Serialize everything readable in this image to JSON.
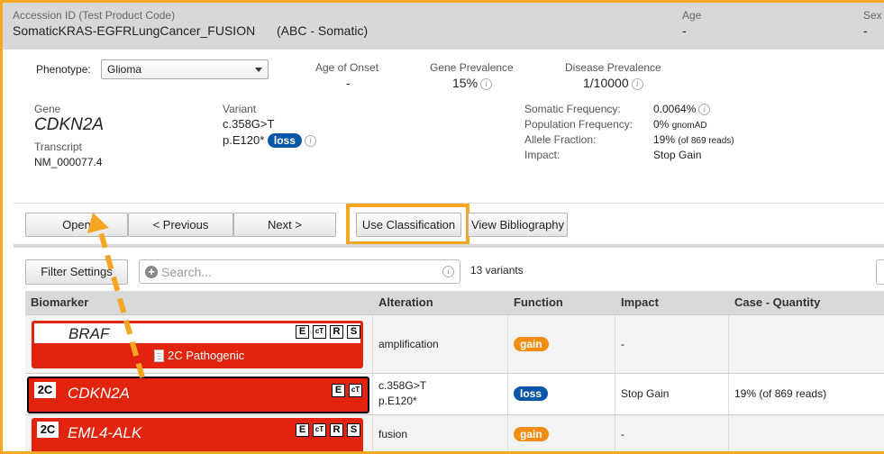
{
  "header": {
    "accession_label": "Accession ID (Test Product Code)",
    "accession_value": "SomaticKRAS-EGFRLungCancer_FUSION",
    "accession_suffix": "(ABC - Somatic)",
    "age_label": "Age",
    "age_value": "-",
    "sex_label": "Sex",
    "sex_value": "-"
  },
  "phenotype": {
    "label": "Phenotype:",
    "selected": "Glioma"
  },
  "stats": {
    "age_onset_label": "Age of Onset",
    "age_onset_value": "-",
    "gene_prev_label": "Gene Prevalence",
    "gene_prev_value": "15%",
    "disease_prev_label": "Disease Prevalence",
    "disease_prev_value": "1/10000"
  },
  "variant_detail": {
    "gene_label": "Gene",
    "gene_value": "CDKN2A",
    "transcript_label": "Transcript",
    "transcript_value": "NM_000077.4",
    "variant_label": "Variant",
    "variant_c": "c.358G>T",
    "variant_p": "p.E120*",
    "function_badge": "loss",
    "somatic_freq_label": "Somatic Frequency:",
    "somatic_freq_value": "0.0064%",
    "pop_freq_label": "Population Frequency:",
    "pop_freq_value": "0%",
    "pop_freq_source": "gnomAD",
    "allele_frac_label": "Allele Fraction:",
    "allele_frac_value": "19%",
    "allele_frac_note": "(of 869 reads)",
    "impact_label": "Impact:",
    "impact_value": "Stop Gain"
  },
  "actions": {
    "open": "Open",
    "previous": "< Previous",
    "next": "Next >",
    "use_classification": "Use Classification",
    "view_bibliography": "View Bibliography"
  },
  "list_toolbar": {
    "filter_settings": "Filter Settings",
    "search_placeholder": "Search...",
    "variant_count": "13 variants"
  },
  "table": {
    "headers": [
      "Biomarker",
      "Alteration",
      "Function",
      "Impact",
      "Case - Quantity"
    ],
    "rows": [
      {
        "tier": "",
        "gene": "BRAF",
        "classification": "2C Pathogenic",
        "evidence": [
          "E",
          "cT",
          "R",
          "S"
        ],
        "alteration_1": "amplification",
        "alteration_2": "",
        "function": "gain",
        "impact": "-",
        "case_quantity": ""
      },
      {
        "tier": "2C",
        "gene": "CDKN2A",
        "classification": "",
        "evidence": [
          "E",
          "cT"
        ],
        "alteration_1": "c.358G>T",
        "alteration_2": "p.E120*",
        "function": "loss",
        "impact": "Stop Gain",
        "case_quantity": "19% (of 869 reads)"
      },
      {
        "tier": "2C",
        "gene": "EML4-ALK",
        "classification": "",
        "evidence": [
          "E",
          "cT",
          "R",
          "S"
        ],
        "alteration_1": "fusion",
        "alteration_2": "",
        "function": "gain",
        "impact": "-",
        "case_quantity": ""
      }
    ]
  },
  "colors": {
    "accent_orange": "#f5a623",
    "biomarker_red": "#e2230d",
    "loss_blue": "#0a56a8",
    "gain_orange": "#f28c12"
  }
}
